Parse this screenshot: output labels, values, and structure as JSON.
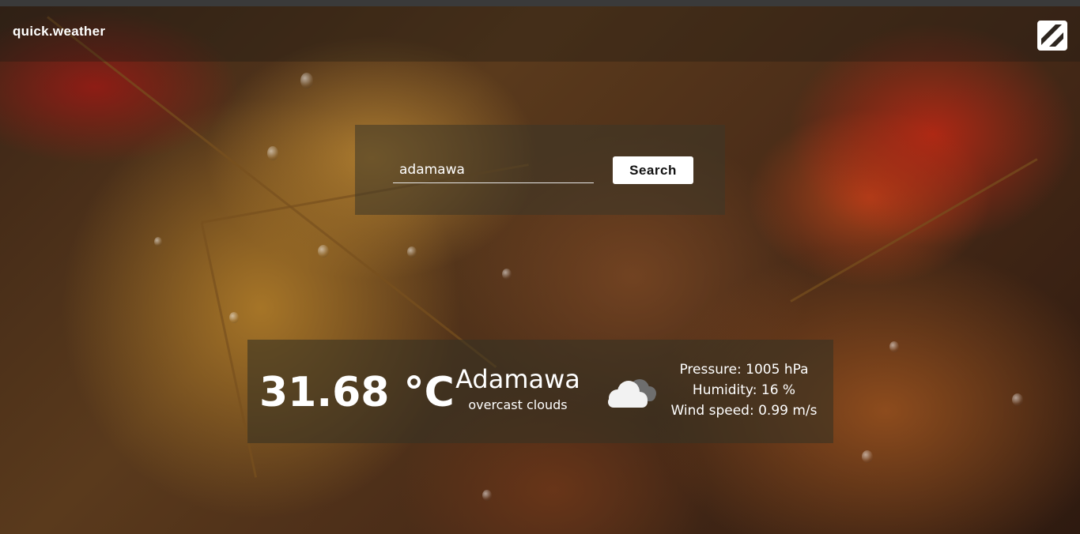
{
  "app": {
    "brand": "quick.weather",
    "logo_icon": "stripe-logo-icon"
  },
  "search": {
    "value": "adamawa",
    "button_label": "Search"
  },
  "weather": {
    "temperature": "31.68 °C",
    "city": "Adamawa",
    "condition": "overcast clouds",
    "condition_icon": "cloud-icon",
    "pressure": "Pressure: 1005 hPa",
    "humidity": "Humidity: 16 %",
    "wind": "Wind speed: 0.99 m/s"
  },
  "colors": {
    "panel": "#37322a",
    "button_bg": "#ffffff",
    "text": "#ffffff"
  }
}
